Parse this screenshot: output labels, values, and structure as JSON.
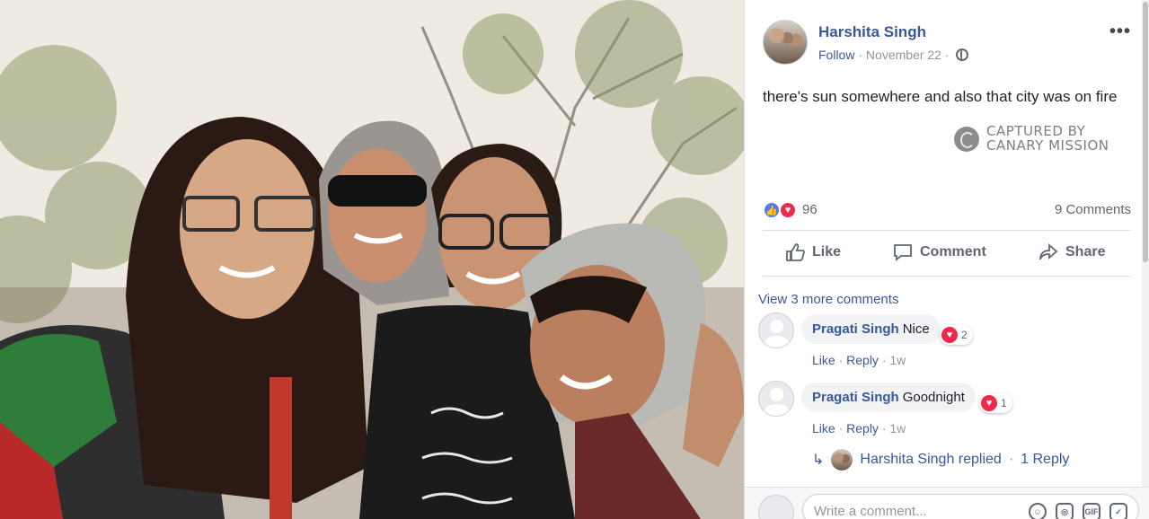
{
  "photo": {
    "description_icon": "selfie-photo"
  },
  "post": {
    "author": "Harshita Singh",
    "follow": "Follow",
    "separator": "·",
    "date": "November 22",
    "menu": "•••",
    "text": "there's sun somewhere and also that city was on fire",
    "watermark_line1": "CAPTURED BY",
    "watermark_line2": "CANARY MISSION"
  },
  "stats": {
    "reaction_count": "96",
    "comments": "9 Comments"
  },
  "actions": {
    "like": "Like",
    "comment": "Comment",
    "share": "Share"
  },
  "comments_section": {
    "view_more": "View 3 more comments",
    "items": [
      {
        "name": "Pragati Singh",
        "text": "Nice",
        "reactions": "2",
        "like": "Like",
        "reply": "Reply",
        "time": "1w"
      },
      {
        "name": "Pragati Singh",
        "text": "Goodnight",
        "reactions": "1",
        "like": "Like",
        "reply": "Reply",
        "time": "1w"
      }
    ],
    "reply_summary": "Harshita Singh replied",
    "reply_link": "1 Reply",
    "write_placeholder": "Write a comment..."
  },
  "colors": {
    "link": "#385898",
    "like": "#4f7bf0",
    "love": "#f0284a"
  }
}
